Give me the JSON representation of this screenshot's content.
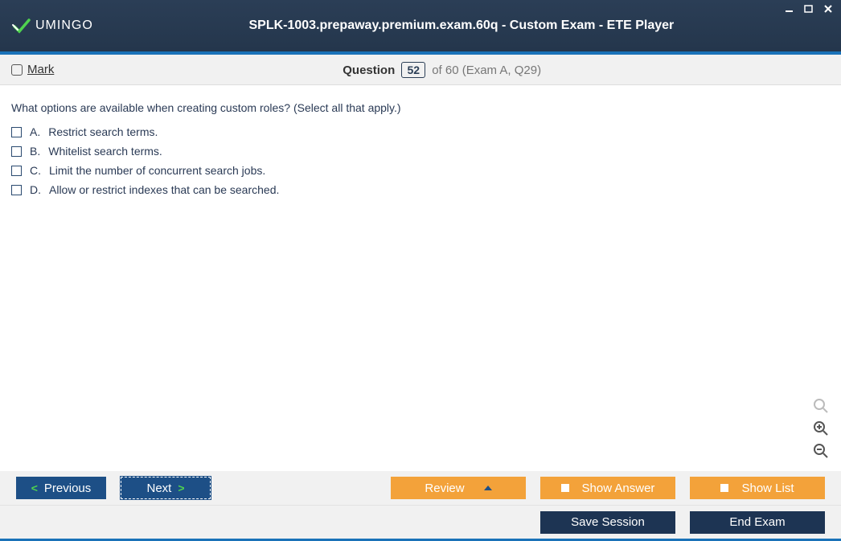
{
  "app": {
    "logo_text": "UMINGO",
    "title": "SPLK-1003.prepaway.premium.exam.60q - Custom Exam - ETE Player"
  },
  "question": {
    "mark_label": "Mark",
    "label_question": "Question",
    "number": "52",
    "of_text": "of 60 (Exam A, Q29)",
    "text": "What options are available when creating custom roles? (Select all that apply.)",
    "options": [
      {
        "letter": "A.",
        "text": "Restrict search terms."
      },
      {
        "letter": "B.",
        "text": "Whitelist search terms."
      },
      {
        "letter": "C.",
        "text": "Limit the number of concurrent search jobs."
      },
      {
        "letter": "D.",
        "text": "Allow or restrict indexes that can be searched."
      }
    ]
  },
  "buttons": {
    "previous": "Previous",
    "next": "Next",
    "review": "Review",
    "show_answer": "Show Answer",
    "show_list": "Show List",
    "save_session": "Save Session",
    "end_exam": "End Exam"
  }
}
